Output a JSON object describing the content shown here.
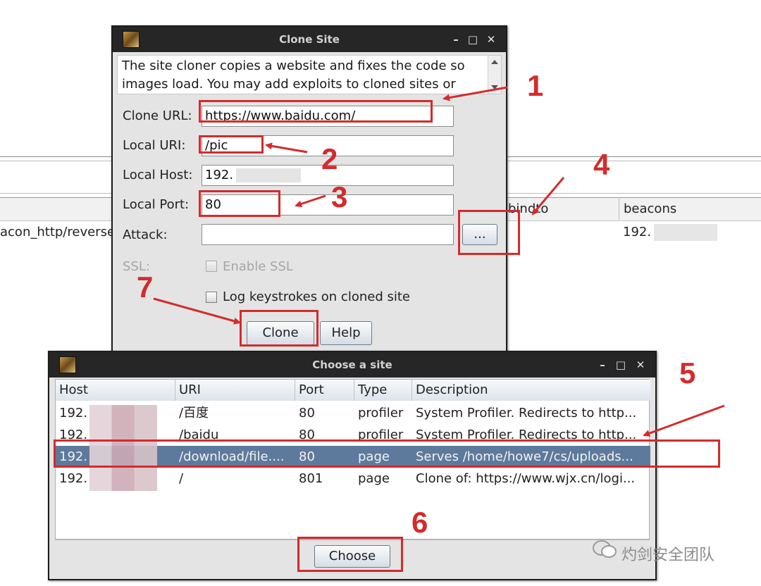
{
  "background_app": {
    "columns": {
      "bindto": "bindto",
      "beacons": "beacons"
    },
    "row": {
      "listener_text": "acon_http/reverse",
      "beacons_value": "192."
    }
  },
  "clone_site_dialog": {
    "title": "Clone Site",
    "description": "The site cloner copies a website and fixes the code so images load. You may add exploits to cloned sites or",
    "clone_url_label": "Clone URL:",
    "clone_url_value": "https://www.baidu.com/",
    "local_uri_label": "Local URI:",
    "local_uri_value": "/pic",
    "local_host_label": "Local Host:",
    "local_host_value": "192.",
    "local_port_label": "Local Port:",
    "local_port_value": "80",
    "attack_label": "Attack:",
    "attack_value": "",
    "attack_browse_label": "...",
    "ssl_label": "SSL:",
    "enable_ssl_label": "Enable SSL",
    "log_keystrokes_label": "Log keystrokes on cloned site",
    "clone_button": "Clone",
    "help_button": "Help"
  },
  "choose_site_dialog": {
    "title": "Choose a site",
    "columns": [
      "Host",
      "URI",
      "Port",
      "Type",
      "Description"
    ],
    "rows": [
      {
        "host": "192.",
        "uri": "/百度",
        "port": "80",
        "type": "profiler",
        "description": "System Profiler. Redirects to http...",
        "selected": false
      },
      {
        "host": "192.",
        "uri": "/baidu",
        "port": "80",
        "type": "profiler",
        "description": "System Profiler. Redirects to http...",
        "selected": false
      },
      {
        "host": "192.",
        "uri": "/download/file....",
        "port": "80",
        "type": "page",
        "description": "Serves /home/howe7/cs/uploads...",
        "selected": true
      },
      {
        "host": "192.",
        "uri": "/",
        "port": "801",
        "type": "page",
        "description": "Clone of: https://www.wjx.cn/logi...",
        "selected": false
      }
    ],
    "choose_button": "Choose"
  },
  "annotations": [
    "1",
    "2",
    "3",
    "4",
    "5",
    "6",
    "7"
  ],
  "watermark": "灼剑安全团队",
  "window_controls": {
    "minimize": "–",
    "maximize": "□",
    "close": "✕"
  },
  "colors": {
    "annotation_red": "#d42b2b",
    "selection": "#5d7a9c",
    "titlebar": "#262626"
  }
}
